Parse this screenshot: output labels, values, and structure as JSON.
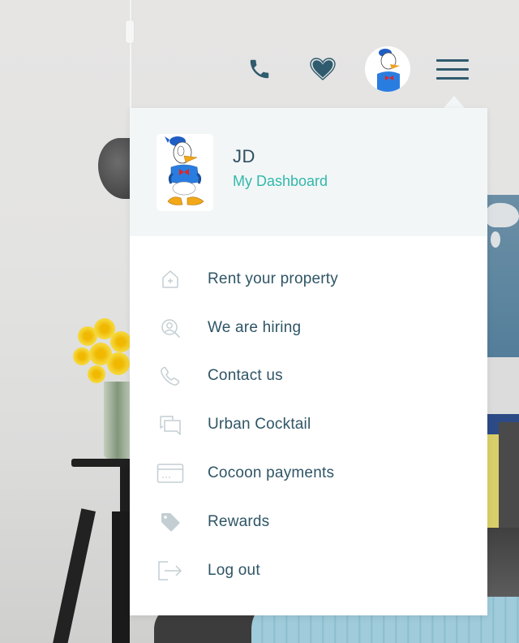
{
  "nav": {
    "phone_icon": "phone-icon",
    "favorites_icon": "heart-icon",
    "avatar_alt": "Donald Duck avatar",
    "menu_icon": "hamburger-menu-icon"
  },
  "profile": {
    "name": "JD",
    "dashboard_link": "My Dashboard"
  },
  "menu": {
    "items": [
      {
        "label": "Rent your property",
        "icon": "house-plus-icon"
      },
      {
        "label": "We are hiring",
        "icon": "user-search-icon"
      },
      {
        "label": "Contact us",
        "icon": "phone-icon"
      },
      {
        "label": "Urban Cocktail",
        "icon": "chat-bubbles-icon"
      },
      {
        "label": "Cocoon payments",
        "icon": "credit-card-icon"
      },
      {
        "label": "Rewards",
        "icon": "tag-icon"
      },
      {
        "label": "Log out",
        "icon": "logout-icon"
      }
    ]
  },
  "colors": {
    "primary_text": "#2f5566",
    "accent_teal": "#33b8aa",
    "nav_icon": "#2f5b6e",
    "menu_icon_gray": "#c3ced3",
    "profile_bg": "#f2f6f7"
  }
}
